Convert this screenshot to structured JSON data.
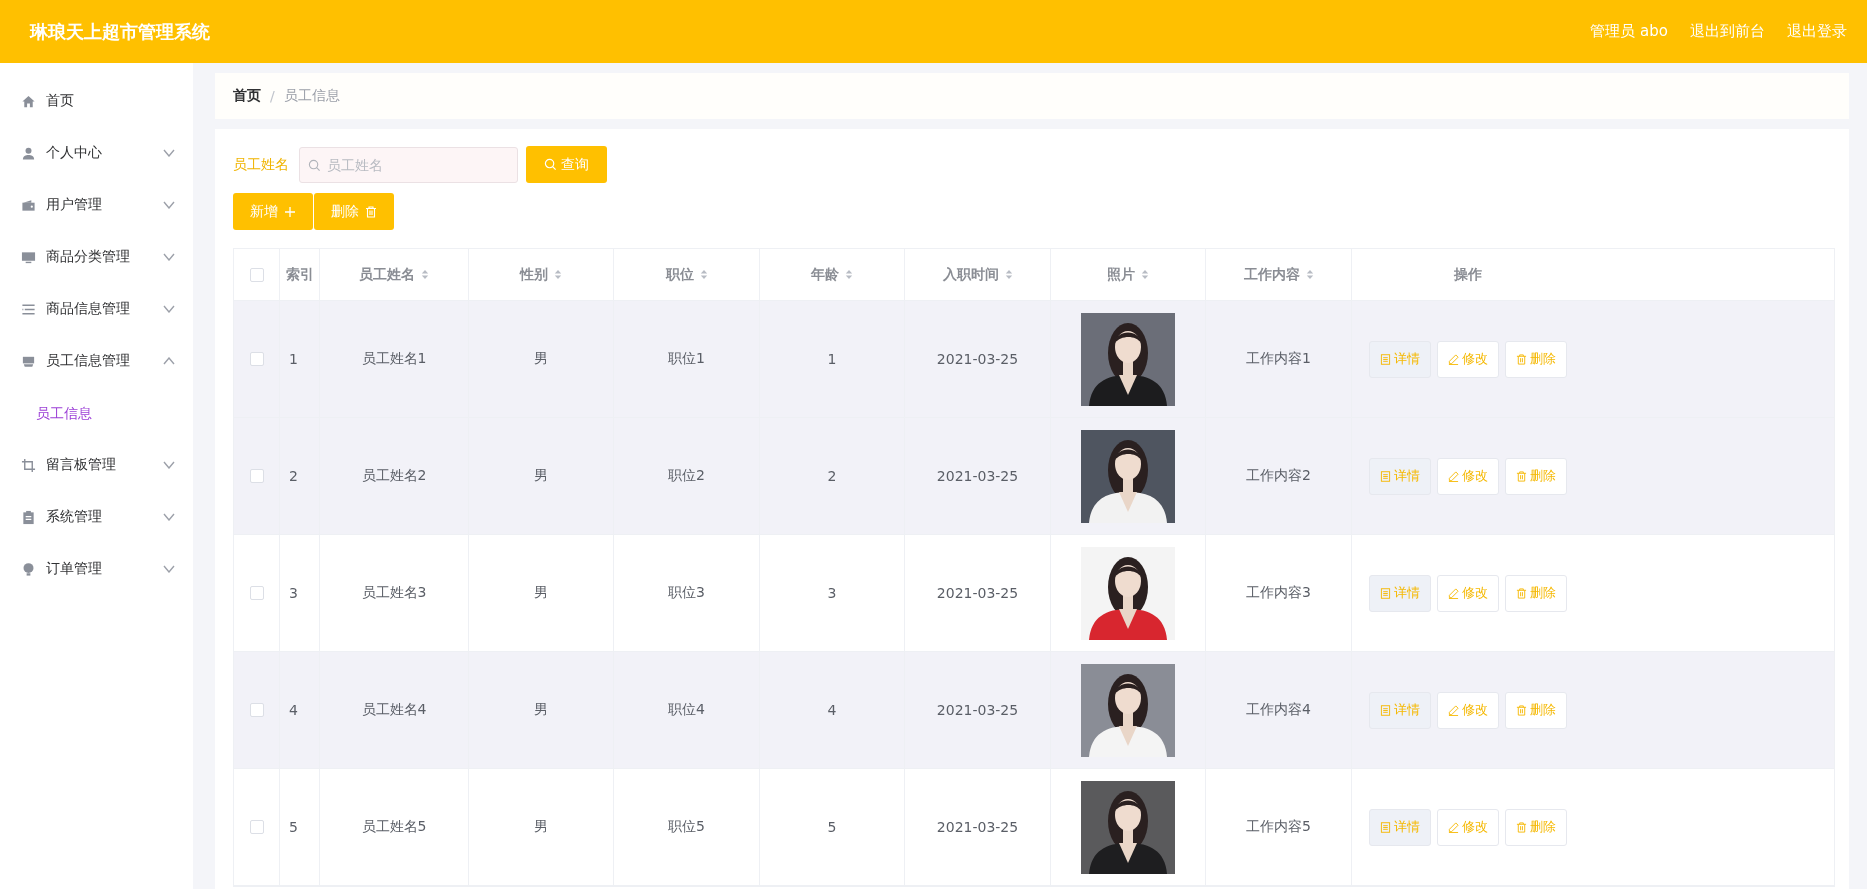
{
  "header": {
    "title": "琳琅天上超市管理系统",
    "links": [
      {
        "label": "管理员 abo"
      },
      {
        "label": "退出到前台"
      },
      {
        "label": "退出登录"
      }
    ]
  },
  "sidebar": {
    "items": [
      {
        "label": "首页"
      },
      {
        "label": "个人中心",
        "expanded": false
      },
      {
        "label": "用户管理",
        "expanded": false
      },
      {
        "label": "商品分类管理",
        "expanded": false
      },
      {
        "label": "商品信息管理",
        "expanded": false
      },
      {
        "label": "员工信息管理",
        "expanded": true,
        "children": [
          {
            "label": "员工信息",
            "selected": true
          }
        ]
      },
      {
        "label": "留言板管理",
        "expanded": false
      },
      {
        "label": "系统管理",
        "expanded": false
      },
      {
        "label": "订单管理",
        "expanded": false
      }
    ]
  },
  "breadcrumb": {
    "separator": "/",
    "items": [
      {
        "label": "首页",
        "current": false
      },
      {
        "label": "员工信息",
        "current": true
      }
    ]
  },
  "search": {
    "label": "员工姓名",
    "placeholder": "员工姓名",
    "button": "查询"
  },
  "actions": [
    {
      "kind": "add",
      "label": "新增"
    },
    {
      "kind": "delete",
      "label": "删除"
    }
  ],
  "table": {
    "select_all_checked": false,
    "columns": [
      {
        "label": "索引",
        "sortable": false
      },
      {
        "label": "员工姓名",
        "sortable": true
      },
      {
        "label": "性别",
        "sortable": true
      },
      {
        "label": "职位",
        "sortable": true
      },
      {
        "label": "年龄",
        "sortable": true
      },
      {
        "label": "入职时间",
        "sortable": true
      },
      {
        "label": "照片",
        "sortable": true
      },
      {
        "label": "工作内容",
        "sortable": true
      },
      {
        "label": "操作",
        "sortable": false
      }
    ],
    "rows": [
      {
        "checked": false,
        "shaded": true,
        "index": "1",
        "name": "员工姓名1",
        "gender": "男",
        "position": "职位1",
        "age": "1",
        "hired": "2021-03-25",
        "work": "工作内容1",
        "buttons": [
          {
            "kind": "detail",
            "label": "详情"
          },
          {
            "kind": "edit",
            "label": "修改"
          },
          {
            "kind": "delete",
            "label": "删除"
          }
        ]
      },
      {
        "checked": false,
        "shaded": true,
        "index": "2",
        "name": "员工姓名2",
        "gender": "男",
        "position": "职位2",
        "age": "2",
        "hired": "2021-03-25",
        "work": "工作内容2",
        "buttons": [
          {
            "kind": "detail",
            "label": "详情"
          },
          {
            "kind": "edit",
            "label": "修改"
          },
          {
            "kind": "delete",
            "label": "删除"
          }
        ]
      },
      {
        "checked": false,
        "shaded": false,
        "index": "3",
        "name": "员工姓名3",
        "gender": "男",
        "position": "职位3",
        "age": "3",
        "hired": "2021-03-25",
        "work": "工作内容3",
        "buttons": [
          {
            "kind": "detail",
            "label": "详情"
          },
          {
            "kind": "edit",
            "label": "修改"
          },
          {
            "kind": "delete",
            "label": "删除"
          }
        ]
      },
      {
        "checked": false,
        "shaded": true,
        "index": "4",
        "name": "员工姓名4",
        "gender": "男",
        "position": "职位4",
        "age": "4",
        "hired": "2021-03-25",
        "work": "工作内容4",
        "buttons": [
          {
            "kind": "detail",
            "label": "详情"
          },
          {
            "kind": "edit",
            "label": "修改"
          },
          {
            "kind": "delete",
            "label": "删除"
          }
        ]
      },
      {
        "checked": false,
        "shaded": false,
        "index": "5",
        "name": "员工姓名5",
        "gender": "男",
        "position": "职位5",
        "age": "5",
        "hired": "2021-03-25",
        "work": "工作内容5",
        "buttons": [
          {
            "kind": "detail",
            "label": "详情"
          },
          {
            "kind": "edit",
            "label": "修改"
          },
          {
            "kind": "delete",
            "label": "删除"
          }
        ]
      }
    ]
  }
}
